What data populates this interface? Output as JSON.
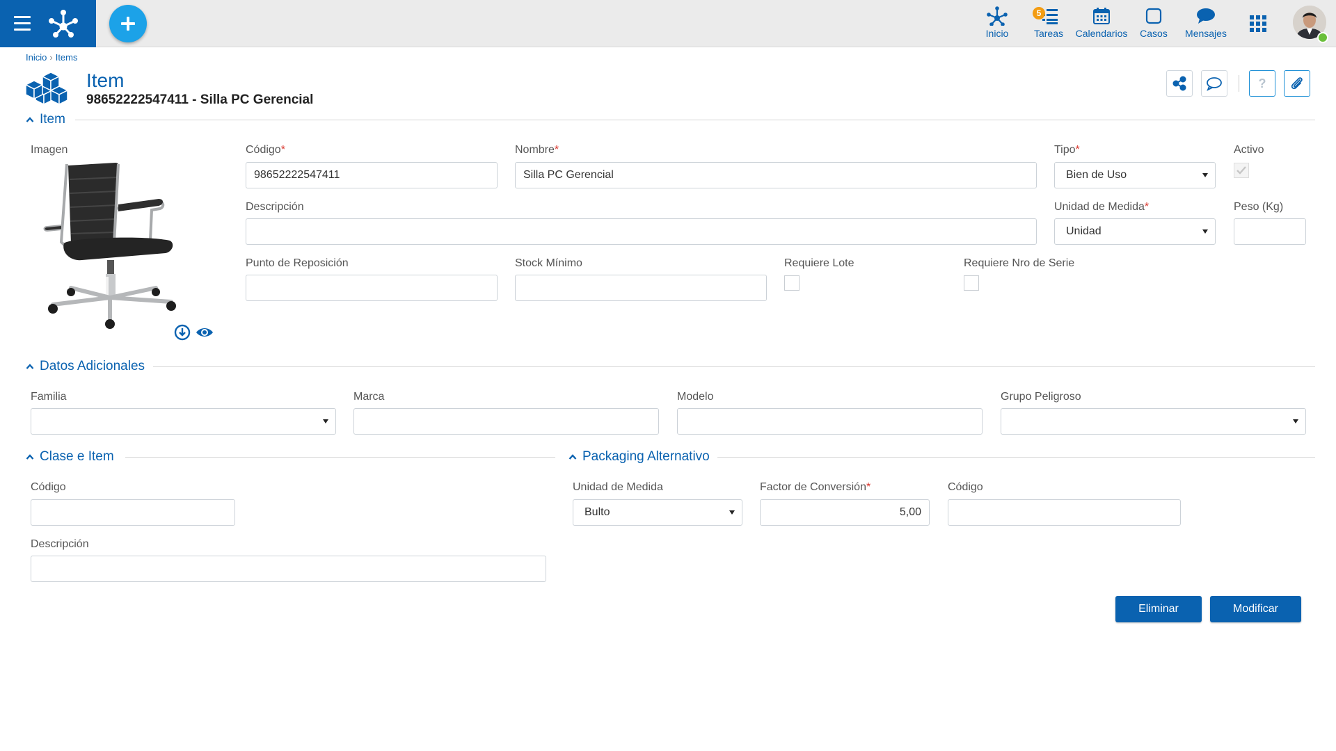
{
  "topbar": {
    "nav": [
      {
        "label": "Inicio",
        "icon": "home-network-icon"
      },
      {
        "label": "Tareas",
        "icon": "tasks-icon",
        "badge": "5"
      },
      {
        "label": "Calendarios",
        "icon": "calendar-icon"
      },
      {
        "label": "Casos",
        "icon": "cases-icon"
      },
      {
        "label": "Mensajes",
        "icon": "chat-icon"
      }
    ],
    "apps_icon": "apps-grid-icon",
    "user_status": "online"
  },
  "breadcrumb": {
    "home": "Inicio",
    "separator": "›",
    "current": "Items"
  },
  "header": {
    "title": "Item",
    "subtitle": "98652222547411 - Silla PC Gerencial"
  },
  "sections": {
    "item": "Item",
    "datos_adicionales": "Datos Adicionales",
    "clase_item": "Clase e Item",
    "packaging": "Packaging Alternativo"
  },
  "item": {
    "imagen_label": "Imagen",
    "codigo_label": "Código",
    "codigo_value": "98652222547411",
    "nombre_label": "Nombre",
    "nombre_value": "Silla PC Gerencial",
    "tipo_label": "Tipo",
    "tipo_value": "Bien de Uso",
    "activo_label": "Activo",
    "descripcion_label": "Descripción",
    "descripcion_value": "",
    "unidad_label": "Unidad de Medida",
    "unidad_value": "Unidad",
    "peso_label": "Peso (Kg)",
    "peso_value": "",
    "punto_label": "Punto de Reposición",
    "punto_value": "",
    "stock_label": "Stock Mínimo",
    "stock_value": "",
    "lote_label": "Requiere Lote",
    "serie_label": "Requiere Nro de Serie",
    "required_mark": "*"
  },
  "datos": {
    "familia_label": "Familia",
    "familia_value": "",
    "marca_label": "Marca",
    "marca_value": "",
    "modelo_label": "Modelo",
    "modelo_value": "",
    "grupo_label": "Grupo Peligroso",
    "grupo_value": ""
  },
  "clase": {
    "codigo_label": "Código",
    "codigo_value": "",
    "descripcion_label": "Descripción",
    "descripcion_value": ""
  },
  "packaging": {
    "unidad_label": "Unidad de Medida",
    "unidad_value": "Bulto",
    "factor_label": "Factor de Conversión",
    "factor_value": "5,00",
    "codigo_label": "Código",
    "codigo_value": ""
  },
  "actions": {
    "eliminar": "Eliminar",
    "modificar": "Modificar"
  },
  "colors": {
    "primary": "#0a62b0",
    "accent": "#1ca2e8",
    "badge": "#f39c12",
    "required": "#d9342b",
    "online": "#6abf3a"
  }
}
